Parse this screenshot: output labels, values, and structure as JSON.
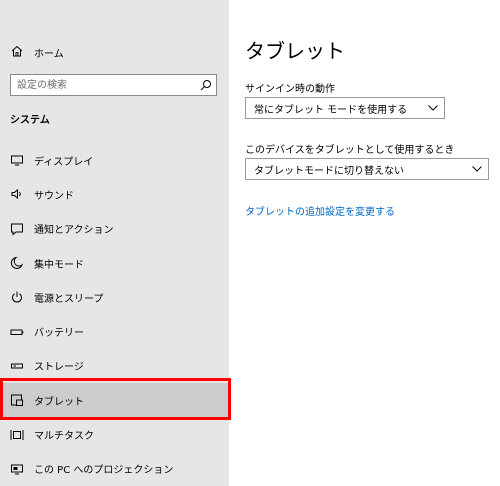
{
  "sidebar": {
    "home_label": "ホーム",
    "search_placeholder": "設定の検索",
    "section_title": "システム",
    "items": [
      {
        "label": "ディスプレイ",
        "icon": "display-icon"
      },
      {
        "label": "サウンド",
        "icon": "speaker-icon"
      },
      {
        "label": "通知とアクション",
        "icon": "notification-icon"
      },
      {
        "label": "集中モード",
        "icon": "moon-icon"
      },
      {
        "label": "電源とスリープ",
        "icon": "power-icon"
      },
      {
        "label": "バッテリー",
        "icon": "battery-icon"
      },
      {
        "label": "ストレージ",
        "icon": "storage-icon"
      },
      {
        "label": "タブレット",
        "icon": "tablet-icon",
        "selected": true
      },
      {
        "label": "マルチタスク",
        "icon": "multitasking-icon"
      },
      {
        "label": "この PC へのプロジェクション",
        "icon": "projection-icon"
      }
    ]
  },
  "main": {
    "title": "タブレット",
    "signin_label": "サインイン時の動作",
    "signin_value": "常にタブレット モードを使用する",
    "device_label": "このデバイスをタブレットとして使用するとき",
    "device_value": "タブレットモードに切り替えない",
    "link_label": "タブレットの追加設定を変更する"
  },
  "colors": {
    "sidebar_bg": "#e6e6e6",
    "selected_bg": "#cccccc",
    "highlight_border": "#ff0000",
    "link": "#0067c0"
  }
}
